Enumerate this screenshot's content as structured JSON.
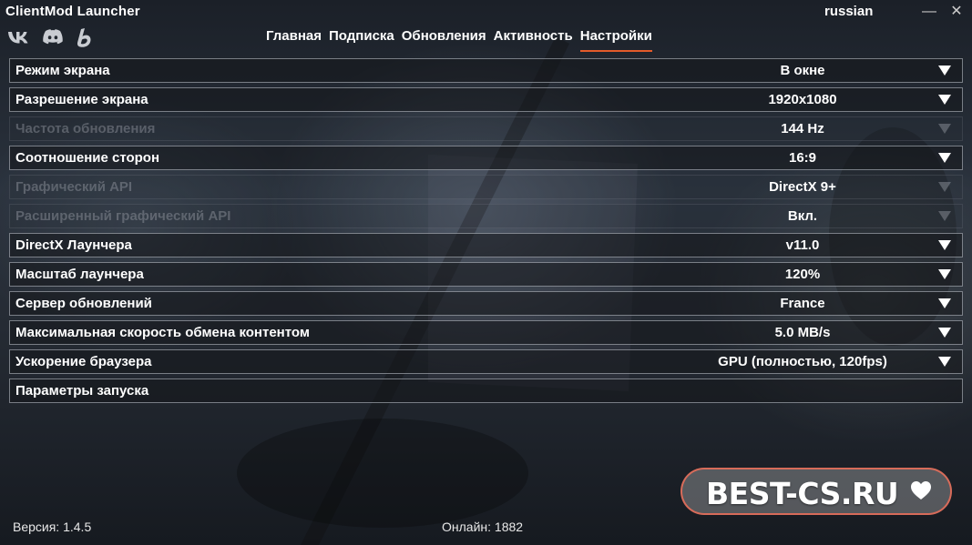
{
  "window": {
    "title": "ClientMod Launcher",
    "language": "russian",
    "minimize_glyph": "—",
    "close_glyph": "✕"
  },
  "social": [
    {
      "icon": "vk-icon"
    },
    {
      "icon": "discord-icon"
    },
    {
      "icon": "b-logo-icon"
    }
  ],
  "nav": {
    "items": [
      "Главная",
      "Подписка",
      "Обновления",
      "Активность",
      "Настройки"
    ],
    "active": "Настройки",
    "accent": "#e35b2a"
  },
  "settings": [
    {
      "label": "Режим экрана",
      "value": "В окне",
      "enabled": true
    },
    {
      "label": "Разрешение экрана",
      "value": "1920x1080",
      "enabled": true
    },
    {
      "label": "Частота обновления",
      "value": "144 Hz",
      "enabled": false
    },
    {
      "label": "Соотношение сторон",
      "value": "16:9",
      "enabled": true
    },
    {
      "label": "Графический API",
      "value": "DirectX 9+",
      "enabled": false
    },
    {
      "label": "Расширенный графический API",
      "value": "Вкл.",
      "enabled": false
    },
    {
      "label": "DirectX Лаунчера",
      "value": "v11.0",
      "enabled": true
    },
    {
      "label": "Масштаб лаунчера",
      "value": "120%",
      "enabled": true
    },
    {
      "label": "Сервер обновлений",
      "value": "France",
      "enabled": true
    },
    {
      "label": "Максимальная скорость обмена контентом",
      "value": "5.0 MB/s",
      "enabled": true
    },
    {
      "label": "Ускорение браузера",
      "value": "GPU (полностью, 120fps)",
      "enabled": true
    },
    {
      "label": "Параметры запуска",
      "value": "",
      "enabled": true
    }
  ],
  "footer": {
    "version": "Версия: 1.4.5",
    "online": "Онлайн: 1882"
  },
  "watermark": {
    "text": "BEST-CS.RU"
  }
}
